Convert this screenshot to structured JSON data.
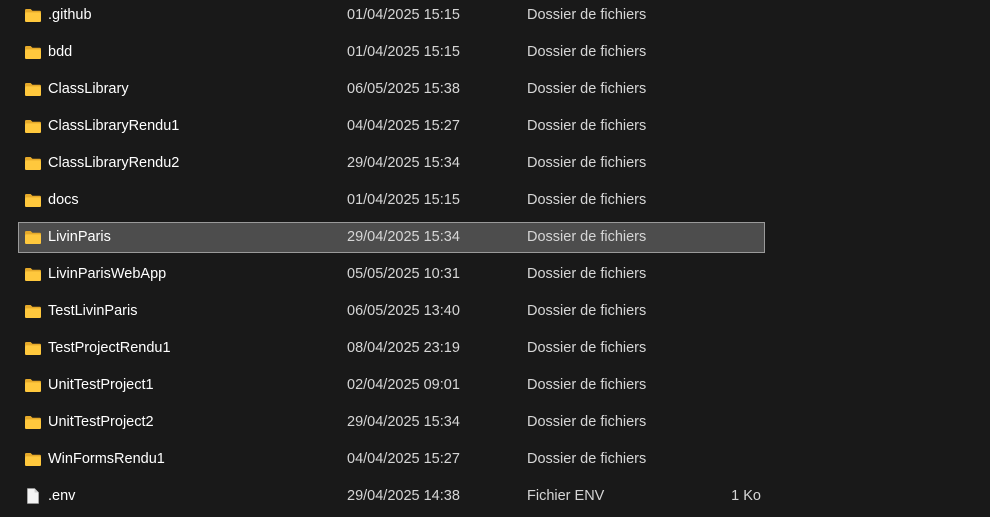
{
  "files": [
    {
      "name": ".github",
      "date": "01/04/2025 15:15",
      "type": "Dossier de fichiers",
      "size": "",
      "kind": "folder",
      "selected": false
    },
    {
      "name": "bdd",
      "date": "01/04/2025 15:15",
      "type": "Dossier de fichiers",
      "size": "",
      "kind": "folder",
      "selected": false
    },
    {
      "name": "ClassLibrary",
      "date": "06/05/2025 15:38",
      "type": "Dossier de fichiers",
      "size": "",
      "kind": "folder",
      "selected": false
    },
    {
      "name": "ClassLibraryRendu1",
      "date": "04/04/2025 15:27",
      "type": "Dossier de fichiers",
      "size": "",
      "kind": "folder",
      "selected": false
    },
    {
      "name": "ClassLibraryRendu2",
      "date": "29/04/2025 15:34",
      "type": "Dossier de fichiers",
      "size": "",
      "kind": "folder",
      "selected": false
    },
    {
      "name": "docs",
      "date": "01/04/2025 15:15",
      "type": "Dossier de fichiers",
      "size": "",
      "kind": "folder",
      "selected": false
    },
    {
      "name": "LivinParis",
      "date": "29/04/2025 15:34",
      "type": "Dossier de fichiers",
      "size": "",
      "kind": "folder",
      "selected": true
    },
    {
      "name": "LivinParisWebApp",
      "date": "05/05/2025 10:31",
      "type": "Dossier de fichiers",
      "size": "",
      "kind": "folder",
      "selected": false
    },
    {
      "name": "TestLivinParis",
      "date": "06/05/2025 13:40",
      "type": "Dossier de fichiers",
      "size": "",
      "kind": "folder",
      "selected": false
    },
    {
      "name": "TestProjectRendu1",
      "date": "08/04/2025 23:19",
      "type": "Dossier de fichiers",
      "size": "",
      "kind": "folder",
      "selected": false
    },
    {
      "name": "UnitTestProject1",
      "date": "02/04/2025 09:01",
      "type": "Dossier de fichiers",
      "size": "",
      "kind": "folder",
      "selected": false
    },
    {
      "name": "UnitTestProject2",
      "date": "29/04/2025 15:34",
      "type": "Dossier de fichiers",
      "size": "",
      "kind": "folder",
      "selected": false
    },
    {
      "name": "WinFormsRendu1",
      "date": "04/04/2025 15:27",
      "type": "Dossier de fichiers",
      "size": "",
      "kind": "folder",
      "selected": false
    },
    {
      "name": ".env",
      "date": "29/04/2025 14:38",
      "type": "Fichier ENV",
      "size": "1 Ko",
      "kind": "file",
      "selected": false
    }
  ],
  "colors": {
    "background": "#191919",
    "selected_background": "#4d4d4d",
    "selected_border": "#9a9a9a",
    "folder_yellow": "#ffc83d"
  }
}
